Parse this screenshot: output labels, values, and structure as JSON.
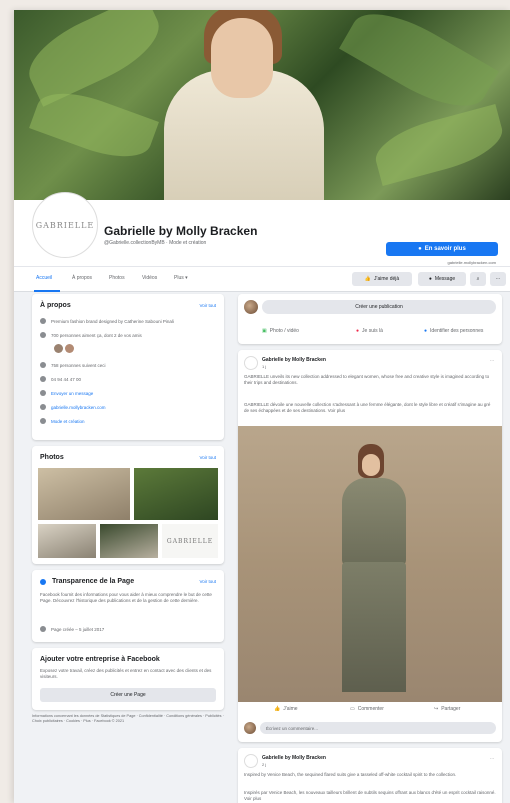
{
  "page": {
    "name": "Gabrielle by Molly Bracken",
    "subtitle": "@Gabrielle.collectionByMB · Mode et création",
    "logo_text": "GABRIELLE",
    "learn_more": "En savoir plus",
    "website": "gabrielle.mollybracken.com"
  },
  "tabs": [
    "Accueil",
    "À propos",
    "Photos",
    "Vidéos",
    "Plus"
  ],
  "actions": {
    "liked": "J'aime déjà",
    "message": "Message",
    "search_icon": "search-icon",
    "more": "···"
  },
  "about": {
    "title": "À propos",
    "see_all": "Voir tout",
    "items": [
      "Premium fashion brand designed by Catherine Sabouni Pinali",
      "700 personnes aiment ça, dont 2 de vos amis",
      "758 personnes suivent ceci",
      "04 94 44 47 00",
      "Envoyer un message",
      "gabrielle.mollybracken.com",
      "Mode et création"
    ]
  },
  "photos": {
    "title": "Photos",
    "see_all": "Voir tout",
    "logo_text": "GABRIELLE"
  },
  "transparency": {
    "title": "Transparence de la Page",
    "see_all": "Voir tout",
    "description": "Facebook fournit des informations pour vous aider à mieux comprendre le but de cette Page. Découvrez l'historique des publications et de la gestion de cette dernière.",
    "created": "Page créée – 5 juillet 2017"
  },
  "business": {
    "title": "Ajouter votre entreprise à Facebook",
    "description": "Exposez votre travail, créez des publicités et entrez en contact avec des clients et des visiteurs.",
    "button": "Créer une Page"
  },
  "footer": "Informations concernant les données de Statistiques de Page · Confidentialité · Conditions générales · Publicités · Choix publicitaires · Cookies · Plus · Facebook © 2021",
  "composer": {
    "button": "Créer une publication",
    "photo": "Photo / vidéo",
    "checkin": "Je suis là",
    "tag": "Identifier des personnes"
  },
  "post1": {
    "author": "Gabrielle by Molly Bracken",
    "time": "1 j",
    "text_en": "GABRIELLE unveils its new collection addressed to elegant women, whose free and creative style is imagined according to their trips and destinations.",
    "text_fr": "GABRIELLE dévoile une nouvelle collection s'adressant à une femme élégante, dont le style libre et créatif s'imagine au gré de ses échappées et de ses destinations. Voir plus",
    "like": "J'aime",
    "comment": "Commenter",
    "share": "Partager",
    "comment_placeholder": "Écrivez un commentaire..."
  },
  "post2": {
    "author": "Gabrielle by Molly Bracken",
    "time": "2 j",
    "text_en": "Inspired by Venice Beach, the sequined flared suits give a tasseled off-white cocktail spirit to the collection.",
    "text_fr": "Inspirés par Venice Beach, les nouveaux tailleurs brillent de subtils sequins offrant aux blancs d'été un esprit cocktail raisonné. Voir plus"
  }
}
